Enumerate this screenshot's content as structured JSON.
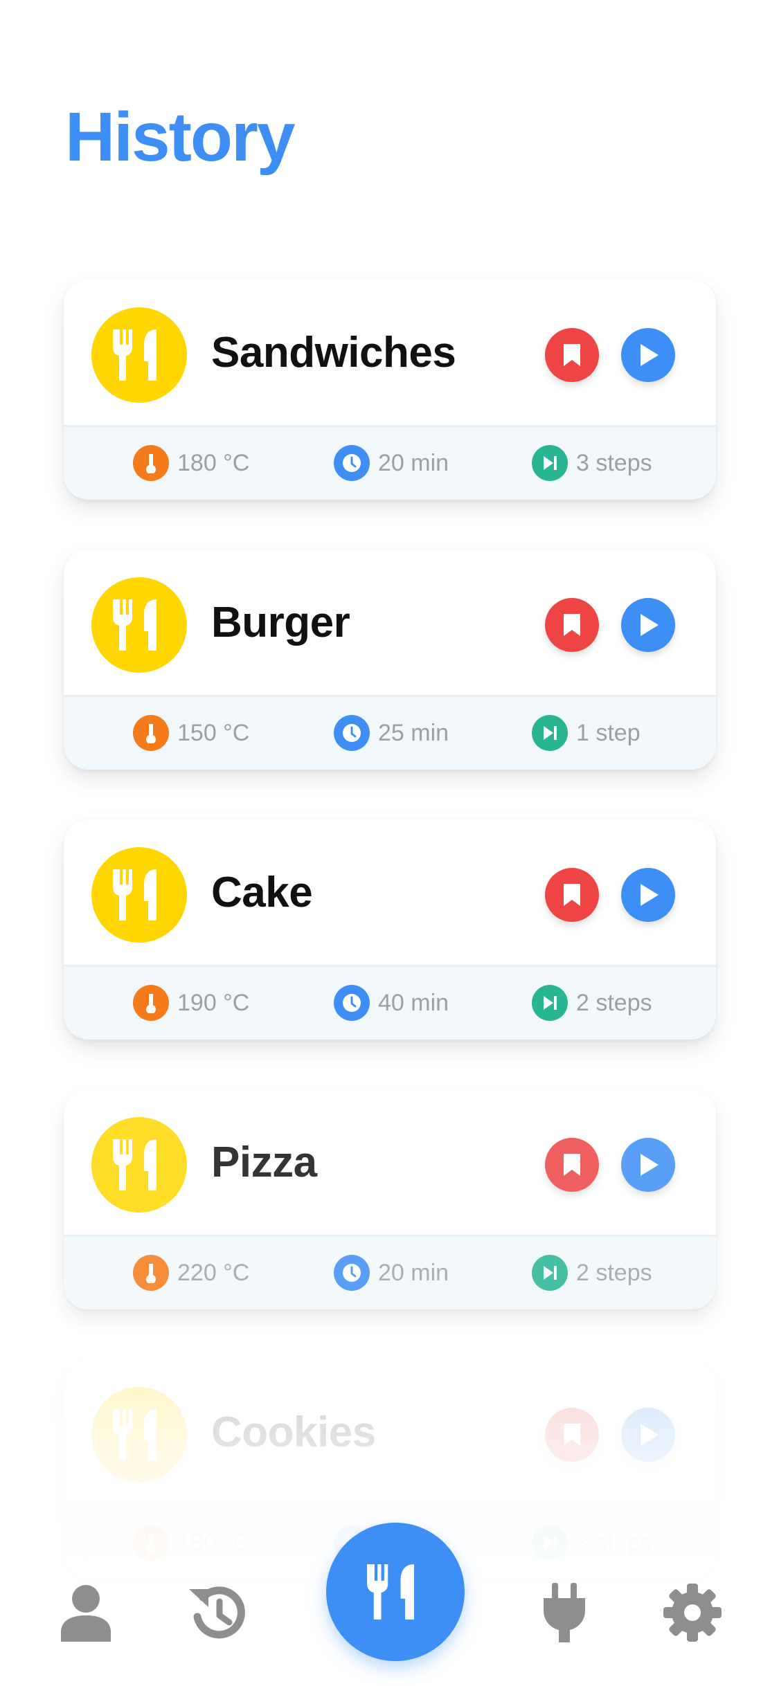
{
  "header": {
    "title": "History"
  },
  "cards": [
    {
      "title": "Sandwiches",
      "temperature": "180 °C",
      "time": "20 min",
      "steps": "3 steps",
      "opacity": 1
    },
    {
      "title": "Burger",
      "temperature": "150 °C",
      "time": "25 min",
      "steps": "1 step",
      "opacity": 1
    },
    {
      "title": "Cake",
      "temperature": "190 °C",
      "time": "40 min",
      "steps": "2 steps",
      "opacity": 1
    },
    {
      "title": "Pizza",
      "temperature": "220 °C",
      "time": "20 min",
      "steps": "2 steps",
      "opacity": 0.85
    },
    {
      "title": "Cookies",
      "temperature": "180 °C",
      "time": "",
      "steps": "3 steps",
      "opacity": 0.3
    }
  ],
  "icons": {
    "avatar": "fork-knife-icon",
    "bookmark": "bookmark-icon",
    "play": "play-icon",
    "temperature": "thermometer-icon",
    "time": "clock-icon",
    "steps": "skip-forward-icon"
  },
  "bottom_nav": [
    {
      "name": "profile",
      "icon": "person-icon"
    },
    {
      "name": "history",
      "icon": "history-icon"
    },
    {
      "name": "recipes",
      "icon": "fork-knife-icon"
    },
    {
      "name": "devices",
      "icon": "plug-icon"
    },
    {
      "name": "settings",
      "icon": "gear-icon"
    }
  ],
  "colors": {
    "accent": "#3d8ff6",
    "avatar_bg": "#ffd600",
    "bookmark": "#ee4444",
    "temperature": "#f57a1a",
    "steps": "#27b592",
    "nav_icon": "#8e8e8e"
  }
}
